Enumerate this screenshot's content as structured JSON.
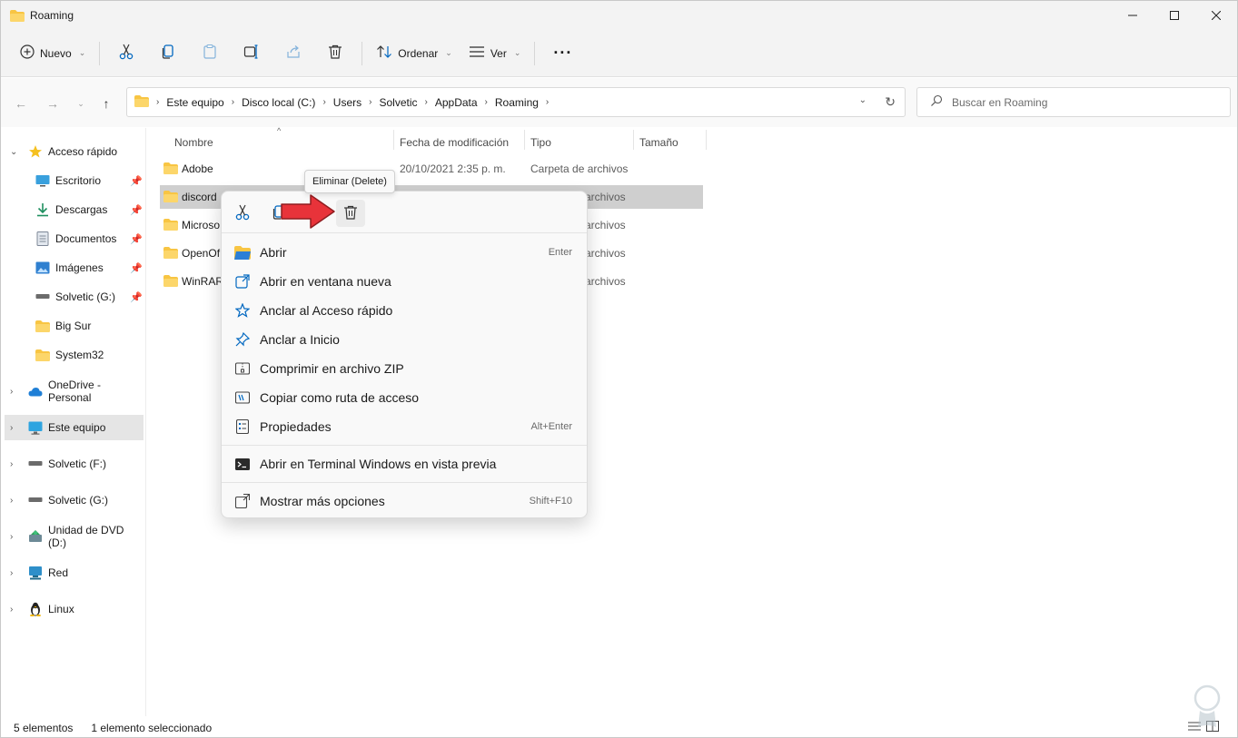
{
  "window": {
    "title": "Roaming"
  },
  "toolbar": {
    "new_label": "Nuevo",
    "sort_label": "Ordenar",
    "view_label": "Ver",
    "more_label": "···"
  },
  "address": {
    "crumbs": [
      "Este equipo",
      "Disco local (C:)",
      "Users",
      "Solvetic",
      "AppData",
      "Roaming"
    ],
    "search_placeholder": "Buscar en Roaming"
  },
  "sidebar": {
    "items": [
      {
        "label": "Acceso rápido",
        "icon": "star-icon"
      },
      {
        "label": "Escritorio",
        "icon": "desktop-icon"
      },
      {
        "label": "Descargas",
        "icon": "download-icon"
      },
      {
        "label": "Documentos",
        "icon": "documents-icon"
      },
      {
        "label": "Imágenes",
        "icon": "pictures-icon"
      },
      {
        "label": "Solvetic (G:)",
        "icon": "drive-icon"
      },
      {
        "label": "Big Sur",
        "icon": "folder-icon"
      },
      {
        "label": "System32",
        "icon": "folder-icon"
      },
      {
        "label": "OneDrive - Personal",
        "icon": "cloud-icon"
      },
      {
        "label": "Este equipo",
        "icon": "computer-icon"
      },
      {
        "label": "Solvetic (F:)",
        "icon": "drive-icon"
      },
      {
        "label": "Solvetic (G:)",
        "icon": "drive-icon"
      },
      {
        "label": "Unidad de DVD (D:)",
        "icon": "dvd-icon"
      },
      {
        "label": "Red",
        "icon": "network-icon"
      },
      {
        "label": "Linux",
        "icon": "linux-icon"
      }
    ]
  },
  "columns": {
    "name": "Nombre",
    "modified": "Fecha de modificación",
    "type": "Tipo",
    "size": "Tamaño"
  },
  "files": [
    {
      "name": "Adobe",
      "modified": "20/10/2021 2:35 p. m.",
      "type": "Carpeta de archivos"
    },
    {
      "name": "discord",
      "modified": "",
      "type": "archivos"
    },
    {
      "name": "Microso",
      "modified": "",
      "type": "archivos"
    },
    {
      "name": "OpenOf",
      "modified": "",
      "type": "archivos"
    },
    {
      "name": "WinRAR",
      "modified": "",
      "type": "archivos"
    }
  ],
  "tooltip": "Eliminar (Delete)",
  "context_menu": {
    "items": [
      {
        "label": "Abrir",
        "shortcut": "Enter",
        "icon": "folder-open-icon"
      },
      {
        "label": "Abrir en ventana nueva",
        "shortcut": "",
        "icon": "open-new-window-icon"
      },
      {
        "label": "Anclar al Acceso rápido",
        "shortcut": "",
        "icon": "star-outline-icon"
      },
      {
        "label": "Anclar a Inicio",
        "shortcut": "",
        "icon": "pin-icon"
      },
      {
        "label": "Comprimir en archivo ZIP",
        "shortcut": "",
        "icon": "zip-icon"
      },
      {
        "label": "Copiar como ruta de acceso",
        "shortcut": "",
        "icon": "copy-path-icon"
      },
      {
        "label": "Propiedades",
        "shortcut": "Alt+Enter",
        "icon": "properties-icon"
      },
      {
        "label": "Abrir en Terminal Windows en vista previa",
        "shortcut": "",
        "icon": "terminal-icon"
      },
      {
        "label": "Mostrar más opciones",
        "shortcut": "Shift+F10",
        "icon": "more-options-icon"
      }
    ]
  },
  "status": {
    "count": "5 elementos",
    "selected": "1 elemento seleccionado"
  },
  "colors": {
    "accent": "#0067c0",
    "folder": "#f8c543",
    "arrow": "#e8333a"
  }
}
